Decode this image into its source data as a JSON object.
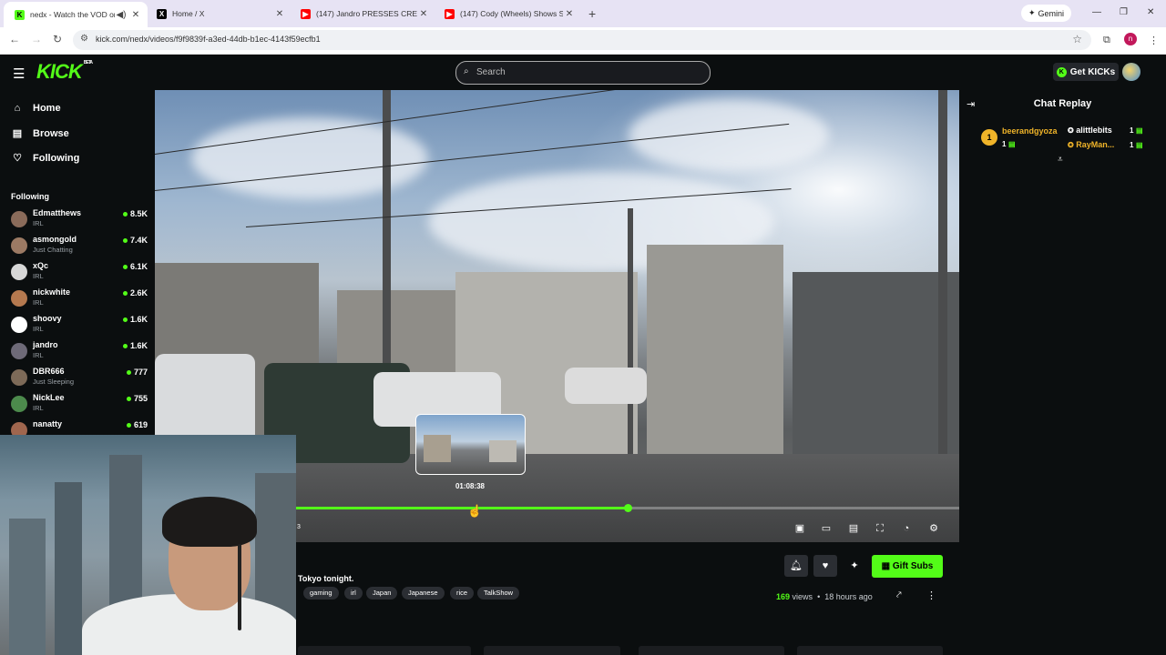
{
  "browser": {
    "tabs": [
      {
        "title": "nedx - Watch the VOD on K",
        "icon": "kick-favicon",
        "active": true
      },
      {
        "title": "Home / X",
        "icon": "x-favicon",
        "active": false
      },
      {
        "title": "(147) Jandro PRESSES CREEPY G",
        "icon": "youtube-favicon",
        "active": false
      },
      {
        "title": "(147) Cody (Wheels) Shows Sh",
        "icon": "youtube-favicon",
        "active": false
      }
    ],
    "gemini_label": "Gemini",
    "url": "kick.com/nedx/videos/f9f9839f-a3ed-44db-b1ec-4143f59ecfb1",
    "profile_initial": "n"
  },
  "header": {
    "logo": "KICK",
    "logo_badge": "BETA",
    "search_placeholder": "Search",
    "get_kicks_label": "Get KICKs"
  },
  "sidebar": {
    "nav": [
      {
        "label": "Home",
        "icon": "home-icon"
      },
      {
        "label": "Browse",
        "icon": "browse-icon"
      },
      {
        "label": "Following",
        "icon": "heart-icon"
      }
    ],
    "following_heading": "Following",
    "following": [
      {
        "name": "Edmatthews",
        "category": "IRL",
        "viewers": "8.5K"
      },
      {
        "name": "asmongold",
        "category": "Just Chatting",
        "viewers": "7.4K"
      },
      {
        "name": "xQc",
        "category": "IRL",
        "viewers": "6.1K"
      },
      {
        "name": "nickwhite",
        "category": "IRL",
        "viewers": "2.6K"
      },
      {
        "name": "shoovy",
        "category": "IRL",
        "viewers": "1.6K"
      },
      {
        "name": "jandro",
        "category": "IRL",
        "viewers": "1.6K"
      },
      {
        "name": "DBR666",
        "category": "Just Sleeping",
        "viewers": "777"
      },
      {
        "name": "NickLee",
        "category": "IRL",
        "viewers": "755"
      },
      {
        "name": "nanatty",
        "category": "",
        "viewers": "619"
      }
    ]
  },
  "player": {
    "preview_time": "01:08:38",
    "progress_fraction": 0.5,
    "hover_fraction": 0.265,
    "time_fragment": "3",
    "controls": [
      "miniplayer-icon",
      "theater-icon",
      "caption-icon",
      "fullscreen-icon",
      "speed-icon",
      "settings-icon"
    ]
  },
  "chat": {
    "title": "Chat Replay",
    "top_gifters": [
      {
        "rank": "1",
        "name": "beerandgyoza",
        "count": "1",
        "color": "#f0b429"
      },
      {
        "rank": "",
        "name": "alittlebits",
        "count": "1",
        "color": "#ffffff"
      },
      {
        "rank": "",
        "name": "RayMan...",
        "count": "1",
        "color": "#f0b429"
      }
    ]
  },
  "video_info": {
    "title": "Tokyo tonight.",
    "tags": [
      "gaming",
      "irl",
      "Japan",
      "Japanese",
      "rice",
      "TalkShow"
    ],
    "gift_subs_label": "Gift Subs",
    "views_count": "169",
    "views_word": "views",
    "separator": "•",
    "age": "18 hours ago"
  },
  "colors": {
    "accent": "#53fc18",
    "background": "#0b0e0f",
    "gold": "#f0b429"
  }
}
